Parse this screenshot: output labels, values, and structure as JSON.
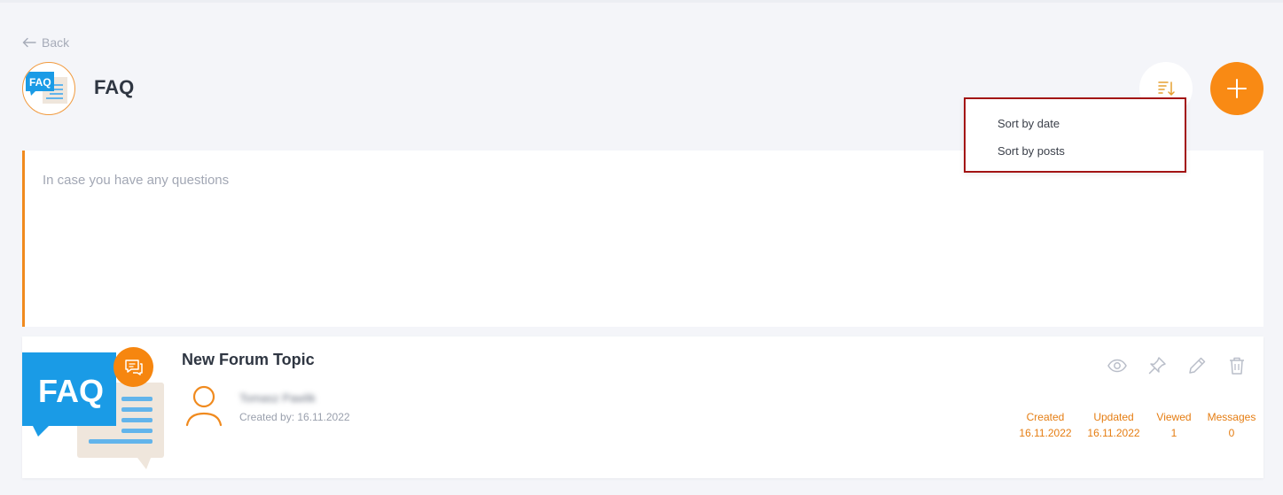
{
  "nav": {
    "back_label": "Back"
  },
  "header": {
    "title": "FAQ",
    "logo_text": "FAQ"
  },
  "sort_menu": {
    "options": [
      "Sort by date",
      "Sort by posts"
    ]
  },
  "description": {
    "text": "In case you have any questions"
  },
  "topic": {
    "title": "New Forum Topic",
    "thumb_text": "FAQ",
    "author": "Tomasz Pawlik",
    "created_by": "Created by: 16.11.2022",
    "stats": {
      "created_label": "Created",
      "created_value": "16.11.2022",
      "updated_label": "Updated",
      "updated_value": "16.11.2022",
      "viewed_label": "Viewed",
      "viewed_value": "1",
      "messages_label": "Messages",
      "messages_value": "0"
    }
  },
  "colors": {
    "accent": "#f98a14",
    "highlight_border": "#a31313",
    "faq_blue": "#1a9be6"
  }
}
